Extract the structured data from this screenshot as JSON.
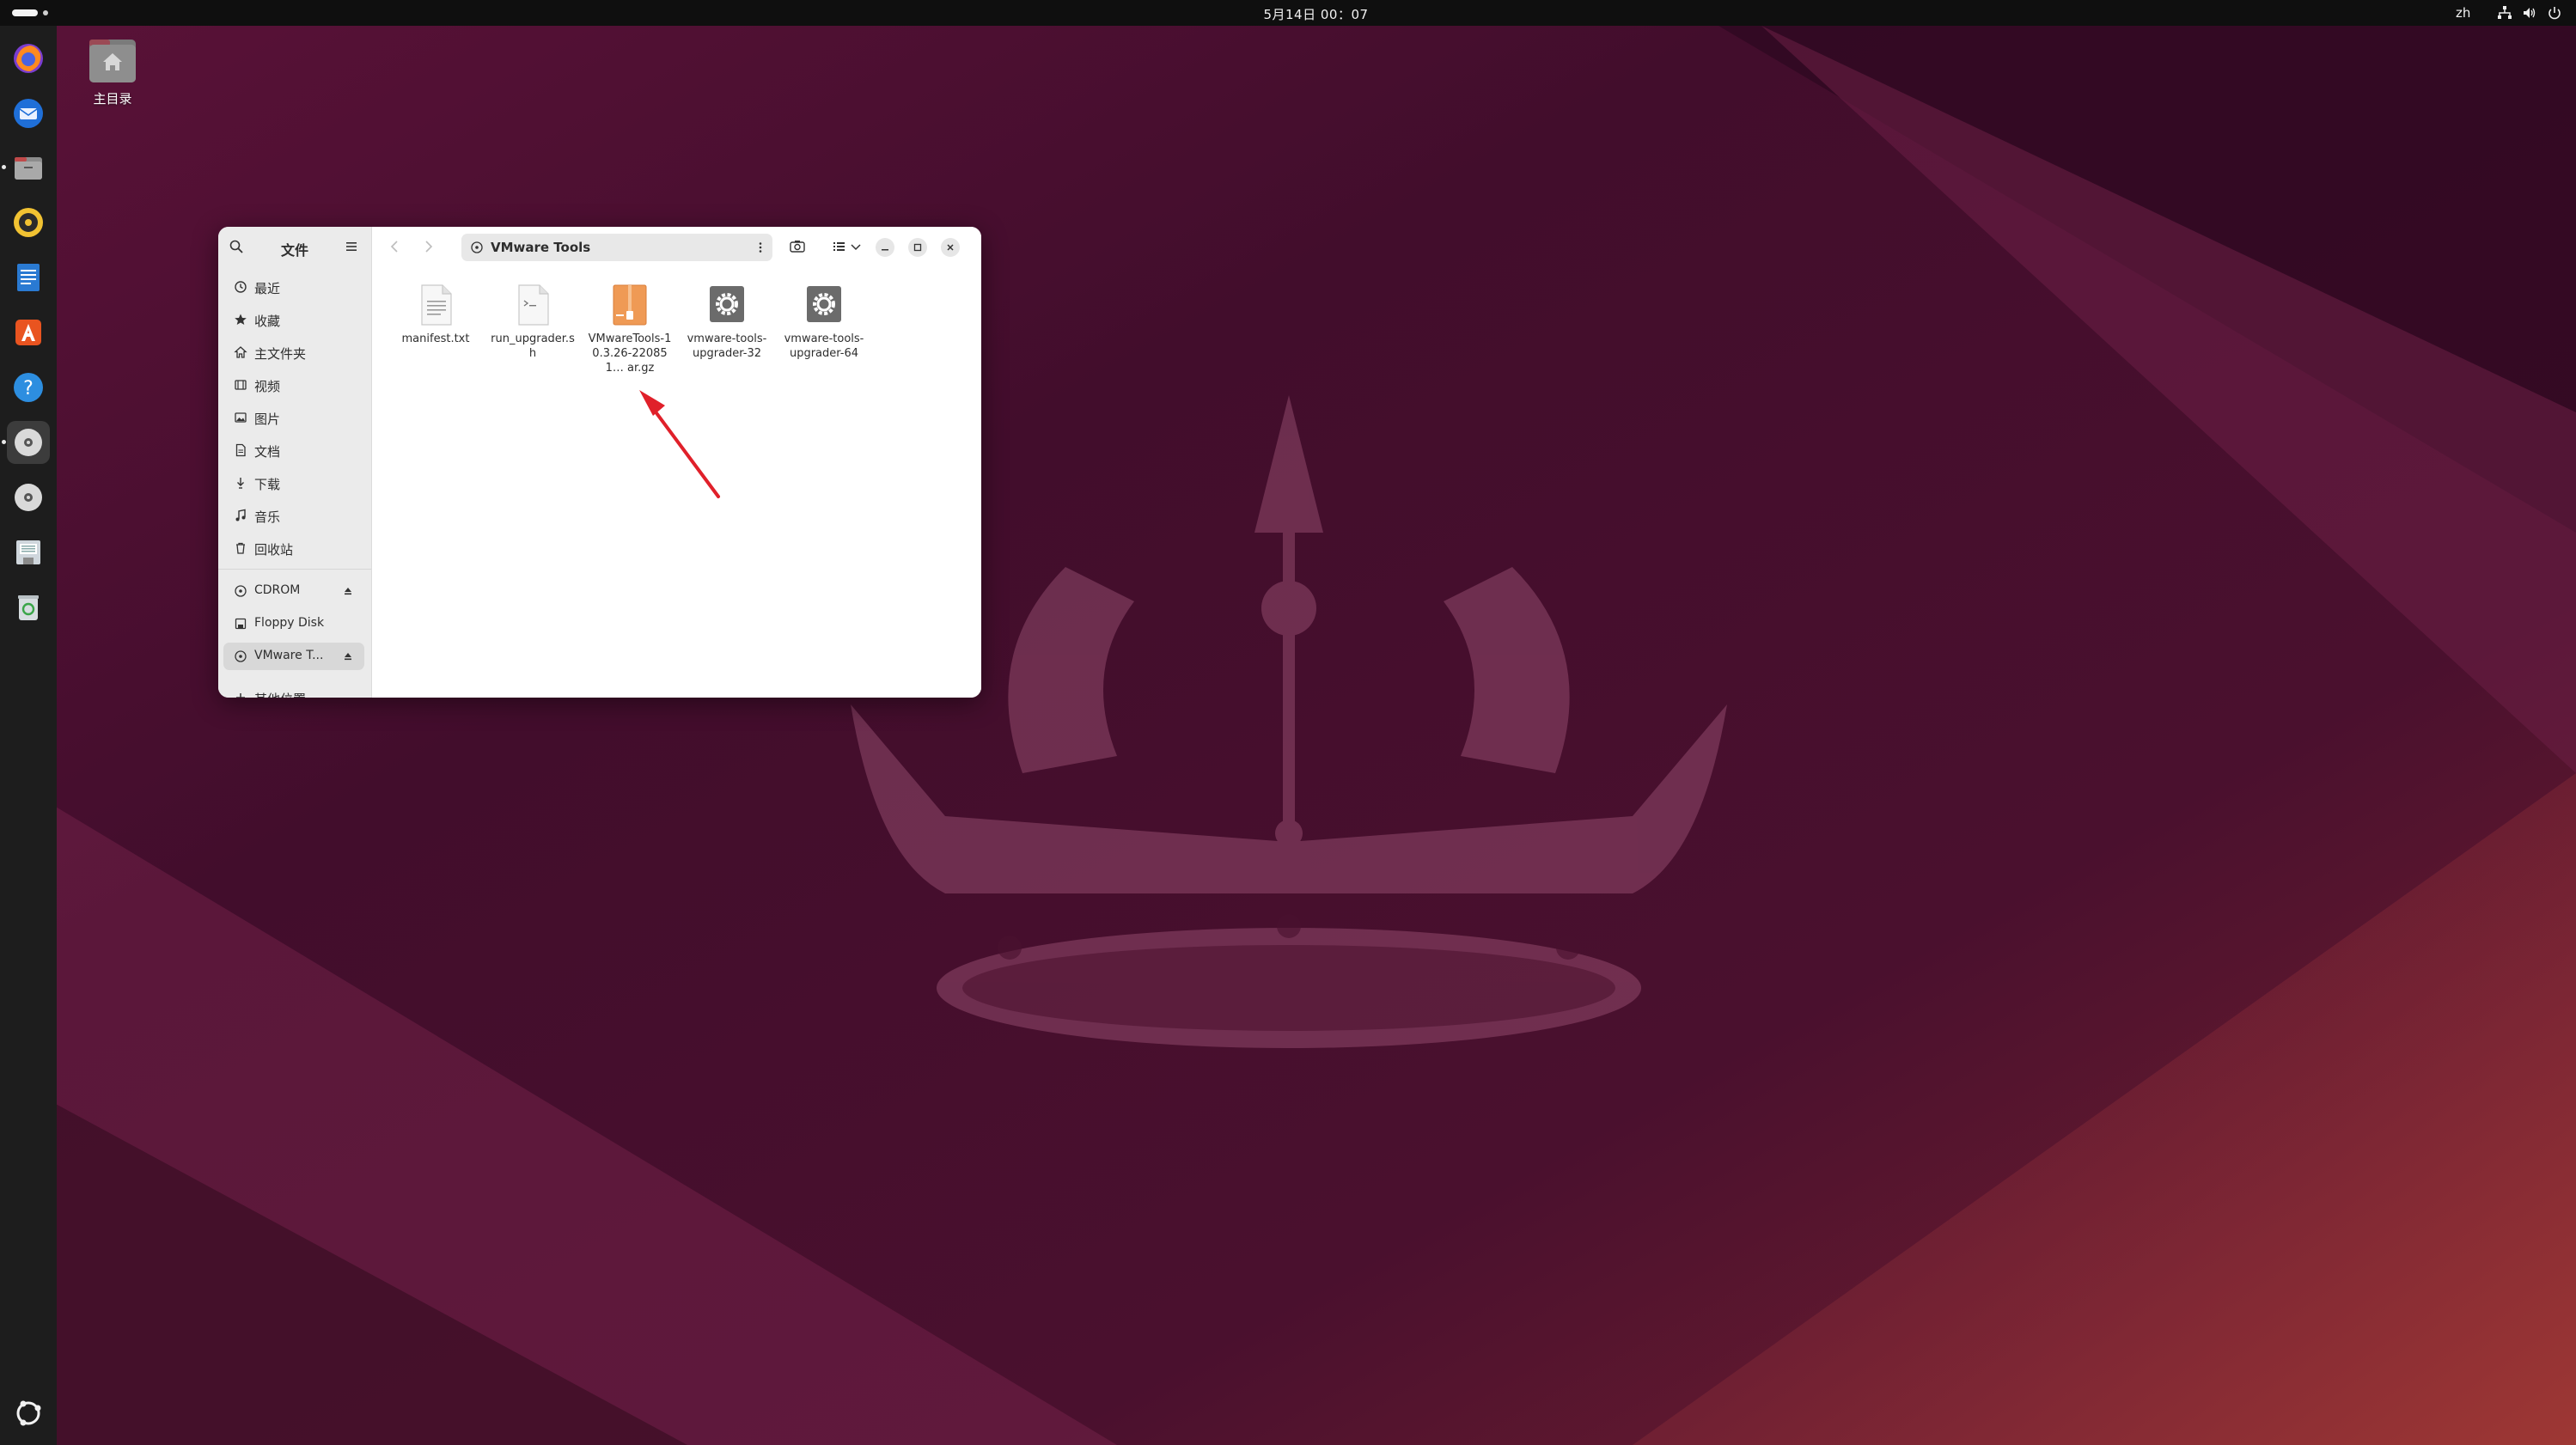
{
  "topbar": {
    "clock": "5月14日  00：07",
    "input_method": "zh"
  },
  "desktop": {
    "home_label": "主目录"
  },
  "dock": {
    "items": [
      {
        "name": "firefox-icon"
      },
      {
        "name": "thunderbird-icon"
      },
      {
        "name": "files-icon"
      },
      {
        "name": "rhythmbox-icon"
      },
      {
        "name": "libreoffice-writer-icon"
      },
      {
        "name": "app-center-icon"
      },
      {
        "name": "help-icon"
      },
      {
        "name": "cdrom-disc-icon"
      },
      {
        "name": "vmware-tools-disc-icon"
      },
      {
        "name": "floppy-drive-icon"
      },
      {
        "name": "trash-icon"
      },
      {
        "name": "show-apps-icon"
      }
    ]
  },
  "window": {
    "sidebar": {
      "title": "文件",
      "places": [
        {
          "label": "最近",
          "icon": "clock-icon"
        },
        {
          "label": "收藏",
          "icon": "star-icon"
        },
        {
          "label": "主文件夹",
          "icon": "home-icon"
        },
        {
          "label": "视频",
          "icon": "video-icon"
        },
        {
          "label": "图片",
          "icon": "image-icon"
        },
        {
          "label": "文档",
          "icon": "document-icon"
        },
        {
          "label": "下载",
          "icon": "download-icon"
        },
        {
          "label": "音乐",
          "icon": "music-icon"
        },
        {
          "label": "回收站",
          "icon": "trash-icon"
        }
      ],
      "devices": [
        {
          "label": "CDROM",
          "icon": "disc-icon",
          "ejectable": true
        },
        {
          "label": "Floppy Disk",
          "icon": "floppy-icon",
          "ejectable": false
        },
        {
          "label": "VMware T...",
          "icon": "disc-icon",
          "ejectable": true
        }
      ],
      "other_locations": "其他位置"
    },
    "pathbar": {
      "location": "VMware Tools"
    },
    "files": [
      {
        "name": "manifest.txt",
        "type": "text"
      },
      {
        "name": "run_upgrader.sh",
        "type": "script"
      },
      {
        "name": "VMwareTools-10.3.26-220851… ar.gz",
        "type": "archive"
      },
      {
        "name": "vmware-tools-upgrader-32",
        "type": "executable"
      },
      {
        "name": "vmware-tools-upgrader-64",
        "type": "executable"
      }
    ]
  },
  "colors": {
    "accent_arrow": "#e0202a",
    "archive_orange": "#ef9a55",
    "dock_bg": "#1d1d1d",
    "topbar_bg": "#0f0f0f"
  }
}
